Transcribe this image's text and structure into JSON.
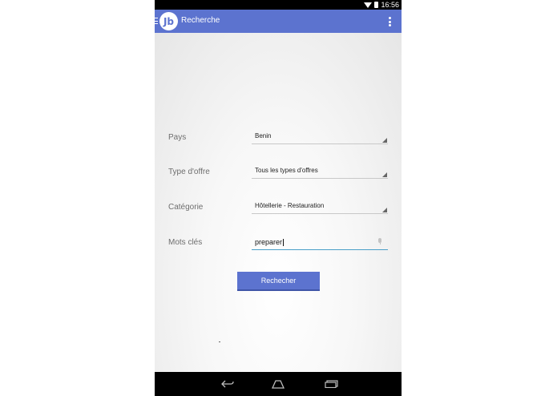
{
  "status_bar": {
    "time": "16:56"
  },
  "app_bar": {
    "title": "Recherche",
    "logo_text": "Jb"
  },
  "form": {
    "pays": {
      "label": "Pays",
      "value": "Benin"
    },
    "type_offre": {
      "label": "Type d'offre",
      "value": "Tous les types d'offres"
    },
    "categorie": {
      "label": "Catégorie",
      "value": "Hôtellerie - Restauration"
    },
    "mots_cles": {
      "label": "Mots clés",
      "value": "preparer"
    },
    "submit_label": "Rechecher"
  },
  "colors": {
    "accent": "#5c73cf",
    "input_underline": "#4a9fc8"
  }
}
